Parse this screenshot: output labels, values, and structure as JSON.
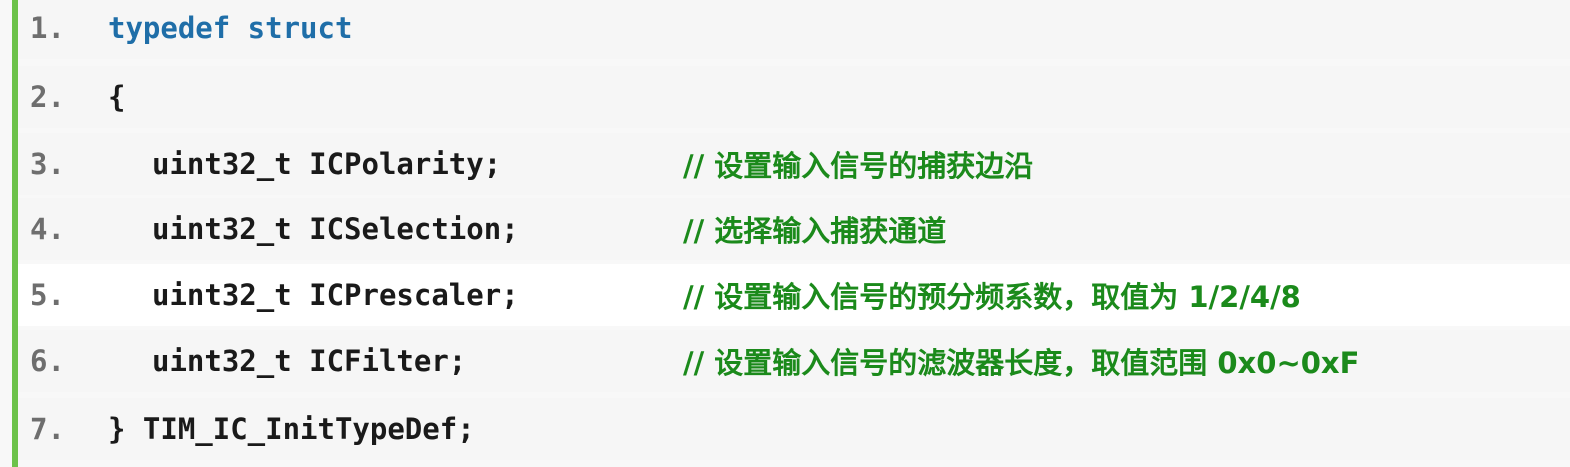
{
  "code": {
    "lines": [
      {
        "num": "1.",
        "parts": [
          {
            "type": "keyword",
            "text": "typedef struct"
          }
        ]
      },
      {
        "num": "2.",
        "parts": [
          {
            "type": "plain",
            "text": "{"
          }
        ]
      },
      {
        "num": "3.",
        "indent": true,
        "parts": [
          {
            "type": "plain",
            "text": "uint32_t ICPolarity;"
          }
        ],
        "comment": "// 设置输入信号的捕获边沿"
      },
      {
        "num": "4.",
        "indent": true,
        "parts": [
          {
            "type": "plain",
            "text": "uint32_t ICSelection;"
          }
        ],
        "comment": "// 选择输入捕获通道"
      },
      {
        "num": "5.",
        "indent": true,
        "parts": [
          {
            "type": "plain",
            "text": "uint32_t ICPrescaler;"
          }
        ],
        "comment": "// 设置输入信号的预分频系数，取值为 1/2/4/8"
      },
      {
        "num": "6.",
        "indent": true,
        "parts": [
          {
            "type": "plain",
            "text": "uint32_t ICFilter;"
          }
        ],
        "comment": "// 设置输入信号的滤波器长度，取值范围 0x0~0xF"
      },
      {
        "num": "7.",
        "parts": [
          {
            "type": "plain",
            "text": "} TIM_IC_InitTypeDef;"
          }
        ]
      }
    ]
  },
  "colors": {
    "accent_bar": "#6cc24a",
    "keyword": "#1f6ea8",
    "comment": "#1b8a1b",
    "line_number": "#6e6e6e"
  }
}
